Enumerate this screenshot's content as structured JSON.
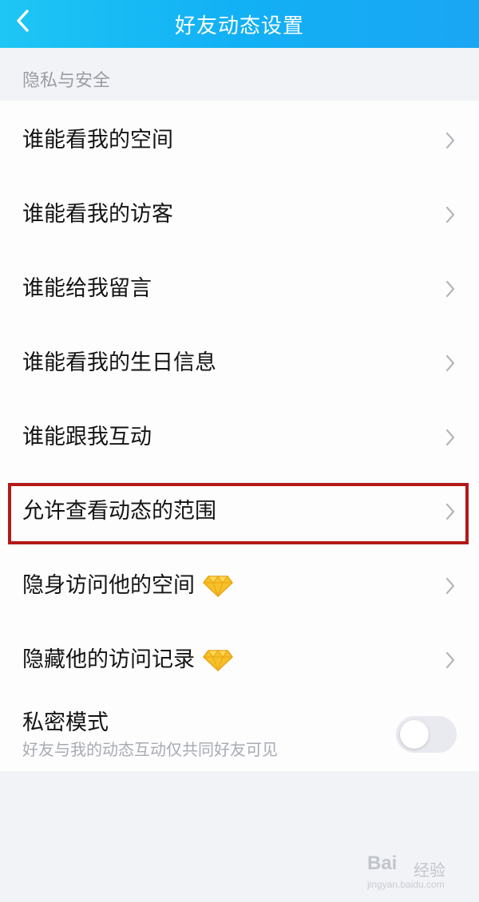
{
  "header": {
    "title": "好友动态设置",
    "back_icon": "chevron-left-icon"
  },
  "section": {
    "title": "隐私与安全"
  },
  "items": [
    {
      "label": "谁能看我的空间",
      "vip": false
    },
    {
      "label": "谁能看我的访客",
      "vip": false
    },
    {
      "label": "谁能给我留言",
      "vip": false
    },
    {
      "label": "谁能看我的生日信息",
      "vip": false
    },
    {
      "label": "谁能跟我互动",
      "vip": false
    },
    {
      "label": "允许查看动态的范围",
      "vip": false,
      "highlighted": true
    },
    {
      "label": "隐身访问他的空间",
      "vip": true
    },
    {
      "label": "隐藏他的访问记录",
      "vip": true
    }
  ],
  "privacy": {
    "title": "私密模式",
    "subtitle": "好友与我的动态互动仅共同好友可见",
    "enabled": false
  },
  "watermark": {
    "logo": "Bai",
    "text": "经验",
    "url": "jingyan.baidu.com"
  },
  "colors": {
    "header_gradient_start": "#1ec6f4",
    "header_gradient_end": "#1aa6f3",
    "highlight_border": "#b31919",
    "diamond": "#f6c02a"
  }
}
